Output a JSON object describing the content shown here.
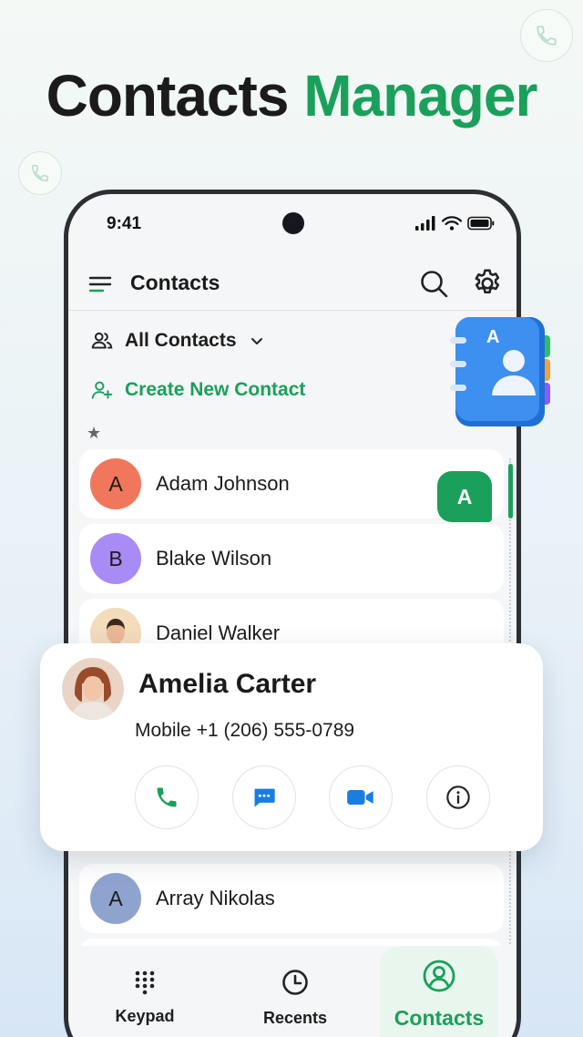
{
  "headline": {
    "part1": "Contacts",
    "part2": "Manager"
  },
  "status_bar": {
    "time": "9:41"
  },
  "appbar": {
    "title": "Contacts"
  },
  "filter": {
    "label": "All Contacts"
  },
  "create": {
    "label": "Create New Contact"
  },
  "favorites_marker": "★",
  "contacts": [
    {
      "initial": "A",
      "name": "Adam Johnson",
      "color": "#f0775c"
    },
    {
      "initial": "B",
      "name": "Blake Wilson",
      "color": "#a98bf5"
    },
    {
      "initial": "",
      "name": "Daniel Walker",
      "color": "#f6e0c3"
    }
  ],
  "index_letter": "A",
  "lower_contact": {
    "initial": "A",
    "name": "Array Nikolas",
    "color": "#8fa3cf"
  },
  "book_icon": {
    "letter": "A"
  },
  "card": {
    "name": "Amelia Carter",
    "phone_line": "Mobile +1 (206) 555-0789",
    "actions": [
      "call-icon",
      "message-icon",
      "video-icon",
      "info-icon"
    ]
  },
  "nav": {
    "keypad": "Keypad",
    "recents": "Recents",
    "contacts": "Contacts"
  },
  "colors": {
    "accent": "#1aa05a",
    "text": "#1b1b1b",
    "blue": "#1a7de0"
  }
}
